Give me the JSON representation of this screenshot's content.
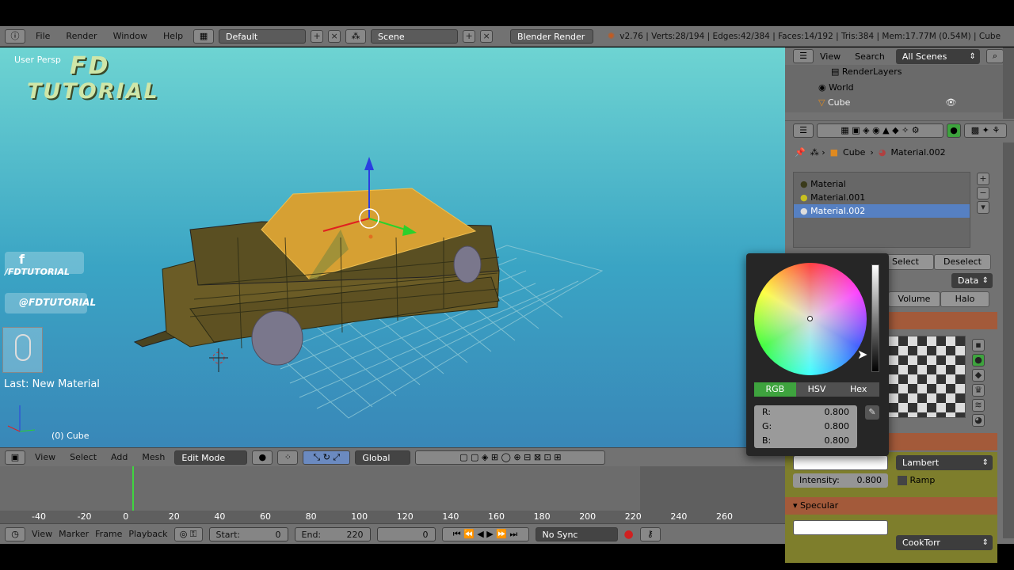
{
  "top": {
    "menu": [
      "File",
      "Render",
      "Window",
      "Help"
    ],
    "layout": "Default",
    "scene": "Scene",
    "engine": "Blender Render",
    "stats": "v2.76 | Verts:28/194 | Edges:42/384 | Faces:14/192 | Tris:384 | Mem:17.77M (0.54M) | Cube"
  },
  "viewport": {
    "persp": "User Persp",
    "watermark1": "FD",
    "watermark2": "TUTORIAL",
    "fb": "/FDTUTORIAL",
    "tw": "@FDTUTORIAL",
    "last_op": "Last: New Material",
    "object": "(0) Cube"
  },
  "vheader": {
    "menu": [
      "View",
      "Select",
      "Add",
      "Mesh"
    ],
    "mode": "Edit Mode",
    "orient": "Global"
  },
  "timeline": {
    "ticks": [
      "-40",
      "-20",
      "0",
      "20",
      "40",
      "60",
      "80",
      "100",
      "120",
      "140",
      "160",
      "180",
      "200",
      "220",
      "240",
      "260"
    ],
    "menu": [
      "View",
      "Marker",
      "Frame",
      "Playback"
    ],
    "start_label": "Start:",
    "start": "0",
    "end_label": "End:",
    "end": "220",
    "frame": "0",
    "sync": "No Sync"
  },
  "outliner": {
    "view": "View",
    "search": "Search",
    "filter": "All Scenes",
    "items": [
      "RenderLayers",
      "World",
      "Cube"
    ]
  },
  "props": {
    "crumb_obj": "Cube",
    "crumb_mat": "Material.002",
    "materials": [
      "Material",
      "Material.001",
      "Material.002"
    ],
    "select": "Select",
    "deselect": "Deselect",
    "data": "Data",
    "tab_volume": "Volume",
    "tab_halo": "Halo",
    "diffuse_shader": "Lambert",
    "intensity_label": "Intensity:",
    "intensity": "0.800",
    "ramp": "Ramp",
    "specular": "Specular",
    "spec_shader": "CookTorr"
  },
  "colorpicker": {
    "modes": [
      "RGB",
      "HSV",
      "Hex"
    ],
    "r_label": "R:",
    "r": "0.800",
    "g_label": "G:",
    "g": "0.800",
    "b_label": "B:",
    "b": "0.800"
  },
  "colors": {
    "accent": "#5680c2",
    "active_green": "#3ea33e",
    "panel": "#727272",
    "section": "#a35a3a"
  }
}
